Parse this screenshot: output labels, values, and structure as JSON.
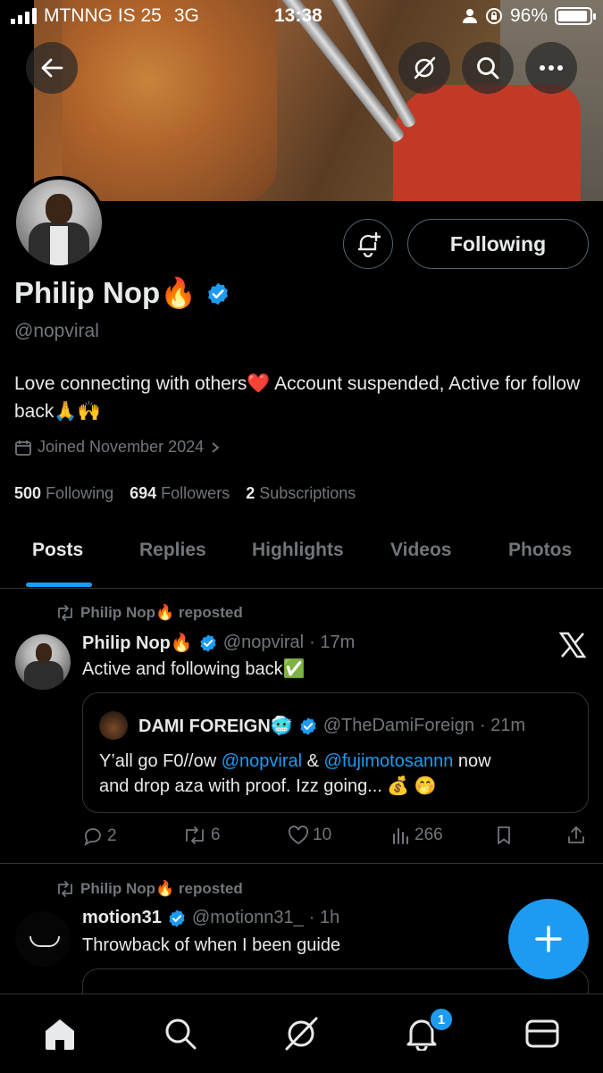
{
  "status_bar": {
    "carrier": "MTNNG IS 25",
    "network": "3G",
    "time": "13:38",
    "battery": "96%"
  },
  "profile": {
    "name": "Philip Nop🔥",
    "handle": "@nopviral",
    "bio": "Love connecting with others❤️ Account suspended, Active for follow back🙏🙌",
    "joined": "Joined November 2024",
    "following_count": "500",
    "following_label": "Following",
    "followers_count": "694",
    "followers_label": "Followers",
    "subscriptions_count": "2",
    "subscriptions_label": "Subscriptions",
    "follow_button": "Following"
  },
  "tabs": [
    {
      "label": "Posts",
      "active": true
    },
    {
      "label": "Replies",
      "active": false
    },
    {
      "label": "Highlights",
      "active": false
    },
    {
      "label": "Videos",
      "active": false
    },
    {
      "label": "Photos",
      "active": false
    }
  ],
  "posts": [
    {
      "repost_label": "Philip Nop🔥 reposted",
      "author": "Philip Nop🔥",
      "handle": "@nopviral",
      "time": "· 17m",
      "text": "Active and following back✅",
      "quote": {
        "author": "DAMI FOREIGN🥶",
        "handle": "@TheDamiForeign",
        "time": "· 21m",
        "text_1": "Y’all go F0//ow ",
        "mention_1": "@nopviral",
        "text_2": " & ",
        "mention_2": "@fujimotosannn",
        "text_3": " now",
        "line_2": "and drop aza with proof. Izz going... 💰 🤭"
      },
      "replies": "2",
      "reposts": "6",
      "likes": "10",
      "views": "266"
    },
    {
      "repost_label": "Philip Nop🔥 reposted",
      "author": "motion31",
      "handle": "@motionn31_",
      "time": "· 1h",
      "text": "Throwback of when I been guide"
    }
  ],
  "notifications_badge": "1",
  "colors": {
    "accent": "#1d9bf0",
    "background": "#000000",
    "secondary_text": "#71767b",
    "border": "#2f3336"
  },
  "icons": [
    "back-arrow-icon",
    "grok-icon",
    "search-icon",
    "more-icon",
    "notification-add-icon",
    "verified-badge-icon",
    "calendar-icon",
    "chevron-right-icon",
    "repost-icon",
    "x-logo-icon",
    "reply-icon",
    "like-icon",
    "views-icon",
    "bookmark-icon",
    "share-icon",
    "compose-plus-icon",
    "home-icon",
    "bell-icon",
    "mail-icon"
  ]
}
